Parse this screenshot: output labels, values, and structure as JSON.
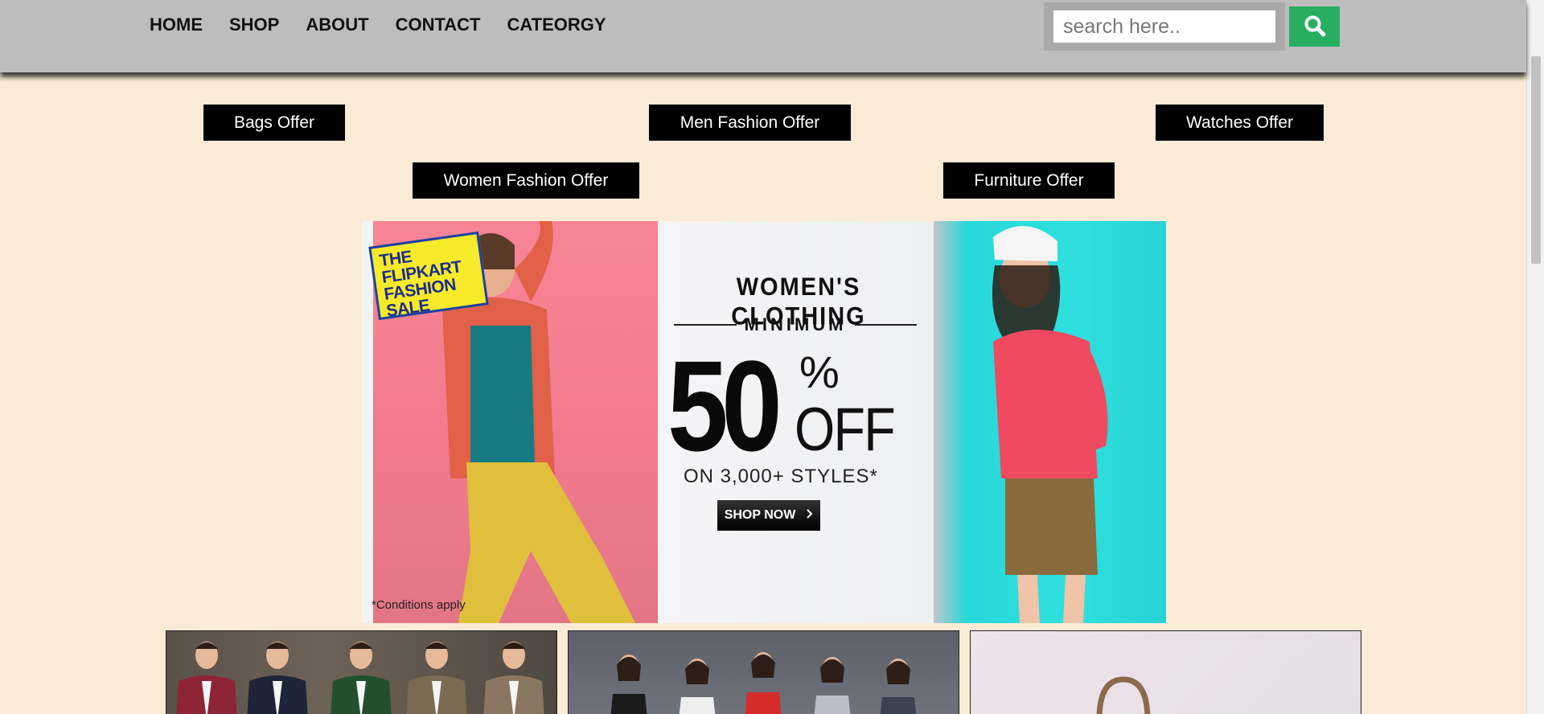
{
  "nav": {
    "items": [
      "HOME",
      "SHOP",
      "ABOUT",
      "CONTACT",
      "CATEORGY"
    ]
  },
  "search": {
    "placeholder": "search here..",
    "icon": "search-icon",
    "button_color": "#27ae60"
  },
  "offers": {
    "bags": "Bags Offer",
    "men": "Men Fashion Offer",
    "watches": "Watches Offer",
    "women": "Women Fashion Offer",
    "furniture": "Furniture Offer"
  },
  "banner": {
    "badge_line1": "THE",
    "badge_line2": "FLIPKART",
    "badge_line3": "FASHION SALE",
    "title": "WOMEN'S CLOTHING",
    "minimum": "MINIMUM",
    "discount": "50",
    "percent": "%",
    "off": "OFF",
    "styles": "ON 3,000+ STYLES*",
    "cta": "SHOP NOW",
    "conditions": "*Conditions apply"
  },
  "colors": {
    "background": "#faebd7",
    "header": "#bdbdbd",
    "offer_button": "#000000"
  }
}
